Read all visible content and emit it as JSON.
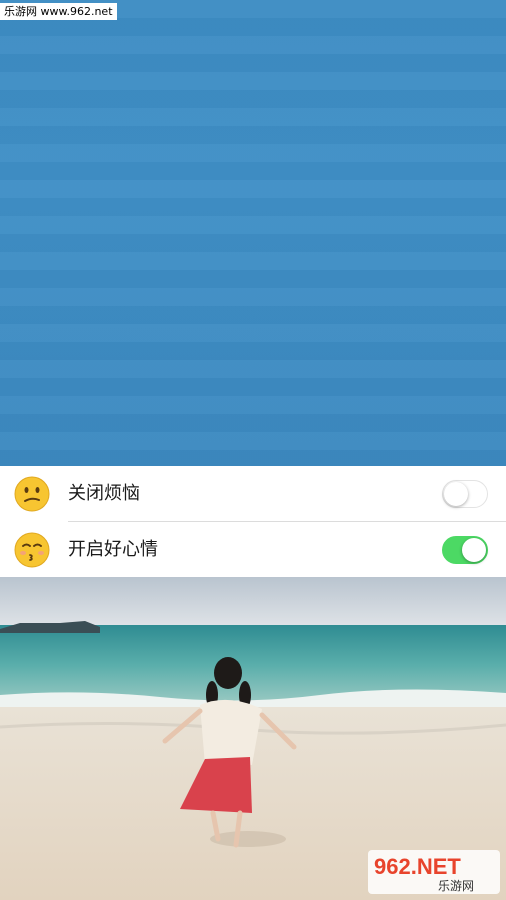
{
  "watermark": {
    "text": "乐游网 www.962.net"
  },
  "settings": {
    "items": [
      {
        "label": "关闭烦恼",
        "icon": "confused-face-icon",
        "toggle": "off"
      },
      {
        "label": "开启好心情",
        "icon": "kissing-face-icon",
        "toggle": "on"
      }
    ],
    "toggle_on_color": "#4cd964"
  },
  "photo": {
    "description_icon": "beach-photo"
  },
  "logo": {
    "brand": "962.NET",
    "subtitle": "乐游网"
  }
}
